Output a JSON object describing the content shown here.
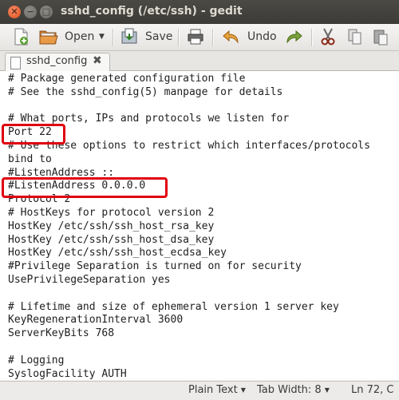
{
  "window": {
    "title": "sshd_config (/etc/ssh) - gedit",
    "close_glyph": "✕",
    "minimize_glyph": "−",
    "maximize_glyph": "□"
  },
  "toolbar": {
    "open_label": "Open",
    "save_label": "Save",
    "undo_label": "Undo"
  },
  "tab": {
    "label": "sshd_config",
    "close_glyph": "✖"
  },
  "editor": {
    "lines": [
      "# Package generated configuration file",
      "# See the sshd_config(5) manpage for details",
      "",
      "# What ports, IPs and protocols we listen for",
      "Port 22",
      "# Use these options to restrict which interfaces/protocols",
      "bind to",
      "#ListenAddress ::",
      "#ListenAddress 0.0.0.0",
      "Protocol 2",
      "# HostKeys for protocol version 2",
      "HostKey /etc/ssh/ssh_host_rsa_key",
      "HostKey /etc/ssh/ssh_host_dsa_key",
      "HostKey /etc/ssh/ssh_host_ecdsa_key",
      "#Privilege Separation is turned on for security",
      "UsePrivilegeSeparation yes",
      "",
      "# Lifetime and size of ephemeral version 1 server key",
      "KeyRegenerationInterval 3600",
      "ServerKeyBits 768",
      "",
      "# Logging",
      "SyslogFacility AUTH"
    ]
  },
  "status": {
    "language": "Plain Text",
    "tab_width": "Tab Width: 8",
    "position": "Ln 72, C"
  },
  "colors": {
    "highlight": "#e00010",
    "close_button": "#e2501f",
    "title_bar": "#3c3b37"
  }
}
